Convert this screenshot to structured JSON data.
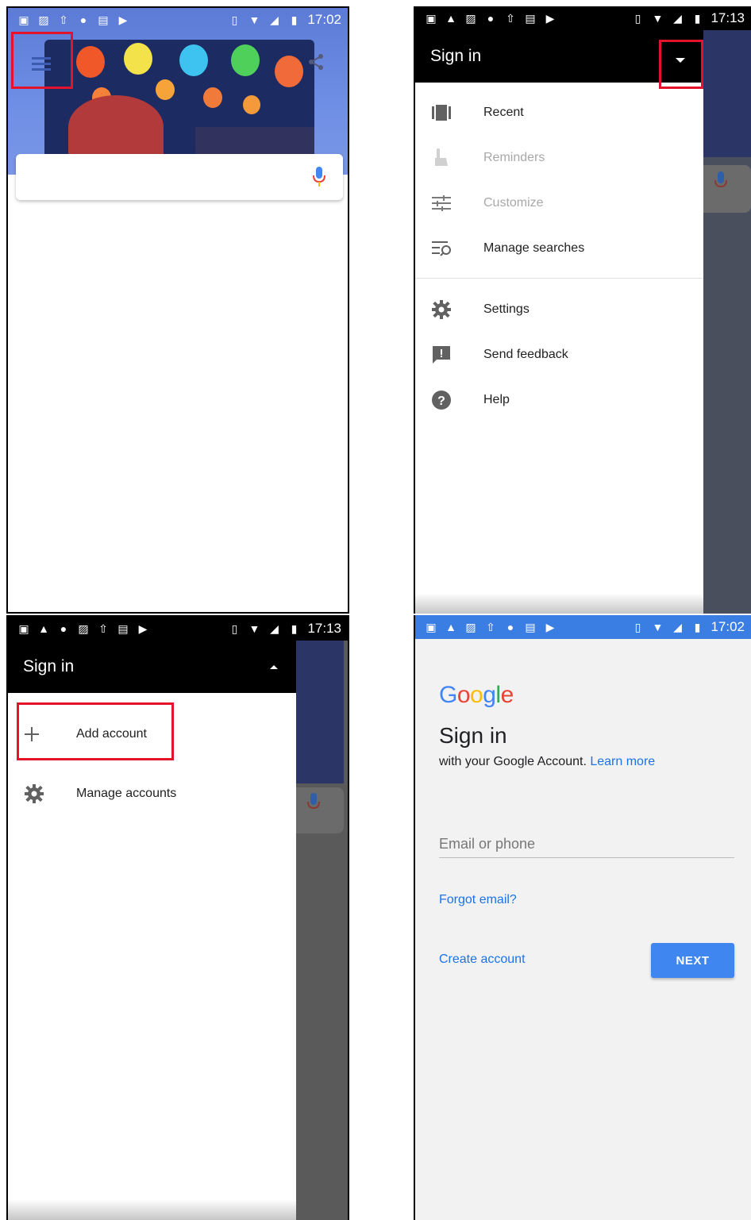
{
  "panel1": {
    "status": {
      "time": "17:02"
    }
  },
  "panel2": {
    "status": {
      "time": "17:13"
    },
    "header_title": "Sign in",
    "menu": [
      {
        "label": "Recent",
        "icon": "recent-icon",
        "enabled": true
      },
      {
        "label": "Reminders",
        "icon": "reminders-icon",
        "enabled": false
      },
      {
        "label": "Customize",
        "icon": "customize-icon",
        "enabled": false
      },
      {
        "label": "Manage searches",
        "icon": "manage-searches-icon",
        "enabled": true
      },
      {
        "label": "Settings",
        "icon": "gear-icon",
        "enabled": true
      },
      {
        "label": "Send feedback",
        "icon": "feedback-icon",
        "enabled": true
      },
      {
        "label": "Help",
        "icon": "help-icon",
        "enabled": true
      }
    ]
  },
  "panel3": {
    "status": {
      "time": "17:13"
    },
    "header_title": "Sign in",
    "items": [
      {
        "label": "Add account",
        "icon": "plus-icon"
      },
      {
        "label": "Manage accounts",
        "icon": "gear-icon"
      }
    ]
  },
  "panel4": {
    "status": {
      "time": "17:02"
    },
    "logo": "Google",
    "title": "Sign in",
    "subtitle": "with your Google Account.",
    "learn_more": "Learn more",
    "email_placeholder": "Email or phone",
    "forgot_email": "Forgot email?",
    "create_account": "Create account",
    "next": "NEXT"
  },
  "colors": {
    "highlight": "#e3132b",
    "link": "#1a73e8",
    "primary_button": "#3f86f1",
    "status_bar_blue": "#3a7de3"
  }
}
